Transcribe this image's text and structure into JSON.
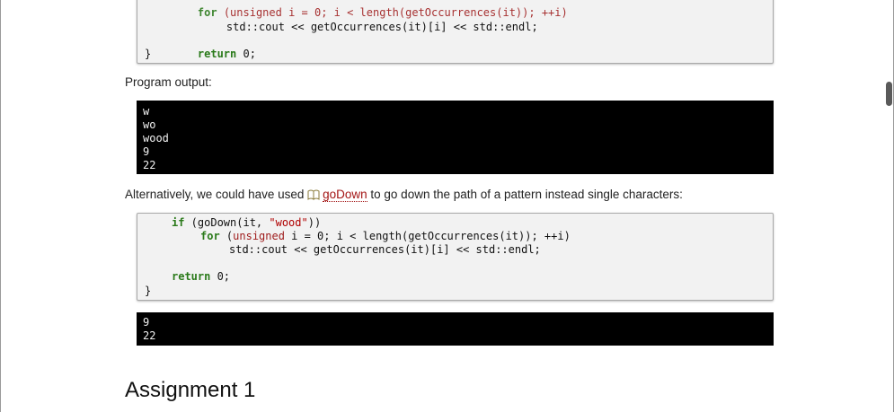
{
  "code_block_1": {
    "lines": [
      {
        "parts": [
          {
            "t": "    for (unsigned i = 0; i < length(getOccurrences(it)); ++i)"
          }
        ]
      },
      {
        "parts": [
          {
            "t": "        std::cout << getOccurrences(it)[i] << std::endl;"
          }
        ]
      },
      {
        "parts": [
          {
            "t": "    return 0;"
          }
        ]
      },
      {
        "parts": [
          {
            "t": "}"
          }
        ]
      }
    ]
  },
  "program_output_label": "Program output:",
  "output_1": [
    "w",
    "wo",
    "wood",
    "9",
    "22"
  ],
  "alt_text": {
    "before": "Alternatively, we could have used ",
    "link": "goDown",
    "after": " to go down the path of a pattern instead single characters:"
  },
  "code_block_2": {
    "line1": {
      "kw": "if",
      "pre": " (goDown(it, ",
      "str": "\"wood\"",
      "post": "))"
    },
    "line2": {
      "kw": "for",
      "pre": " (",
      "ty": "unsigned",
      "post": " i = 0; i < length(getOccurrences(it)); ++i)"
    },
    "line3": "std::cout << getOccurrences(it)[i] << std::endl;",
    "line4": {
      "kw": "return",
      "post": " 0;"
    },
    "line5": "}"
  },
  "output_2": [
    "9",
    "22"
  ],
  "assignment_heading": "Assignment 1",
  "colors": {
    "keyword": "#2a7a1a",
    "type": "#9e1a1a",
    "string": "#b00000",
    "link": "#a31515",
    "output_bg": "#000000"
  },
  "icons": {
    "doc_link": "book-icon"
  }
}
